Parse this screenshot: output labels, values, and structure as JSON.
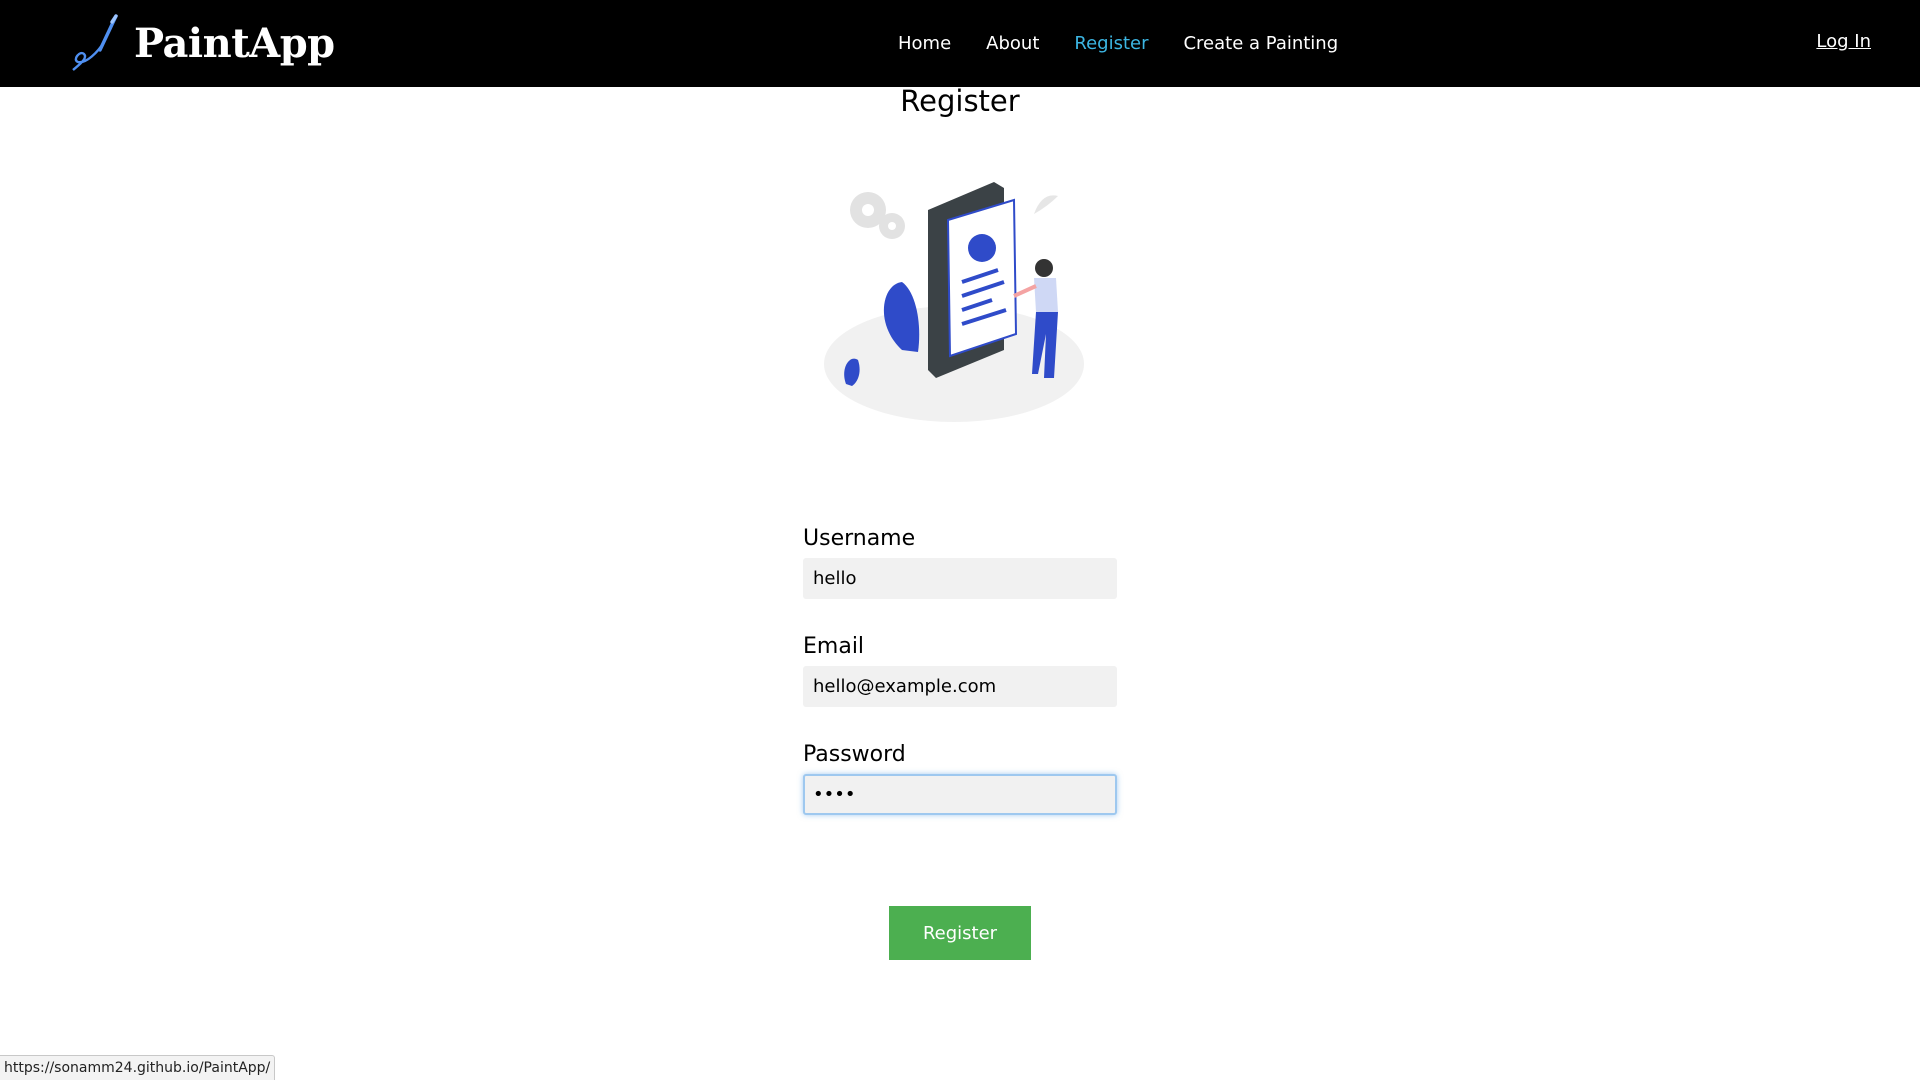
{
  "nav": {
    "brand": "PaintApp",
    "links": [
      "Home",
      "About",
      "Register",
      "Create a Painting"
    ],
    "active": "Register",
    "login": "Log In"
  },
  "page": {
    "title": "Register"
  },
  "form": {
    "username": {
      "label": "Username",
      "value": "hello"
    },
    "email": {
      "label": "Email",
      "value": "hello@example.com"
    },
    "password": {
      "label": "Password",
      "value": "••••"
    },
    "submit": "Register"
  },
  "status_url": "https://sonamm24.github.io/PaintApp/",
  "colors": {
    "accent": "#3cb6e3",
    "button": "#4caf50",
    "illustration_blue": "#2f4bc9"
  }
}
